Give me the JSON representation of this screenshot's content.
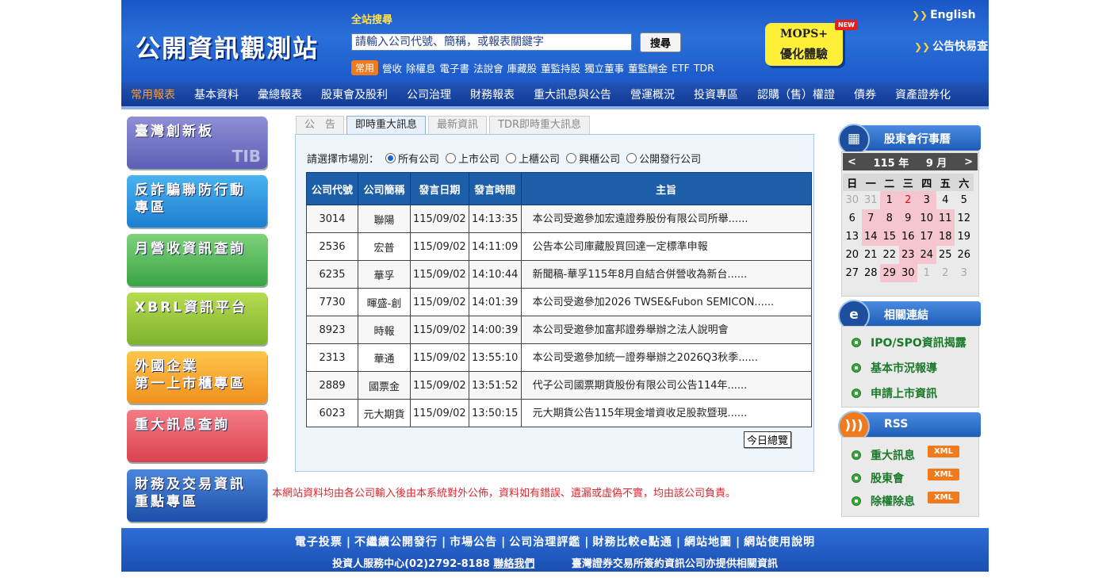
{
  "header": {
    "logo": "公開資訊觀測站",
    "search_label": "全站搜尋",
    "search_placeholder": "請輸入公司代號、簡稱，或報表關鍵字",
    "search_button": "搜尋",
    "quick_tag": "常用",
    "quick_links": [
      "營收",
      "除權息",
      "電子書",
      "法說會",
      "庫藏股",
      "董監持股",
      "獨立董事",
      "董監酬金",
      "ETF",
      "TDR"
    ],
    "mops_line1": "MOPS+",
    "mops_line2": "優化體驗",
    "mops_new": "NEW",
    "english": "English",
    "quick_announce": "公告快易查"
  },
  "nav": [
    "常用報表",
    "基本資料",
    "彙總報表",
    "股東會及股利",
    "公司治理",
    "財務報表",
    "重大訊息與公告",
    "營運概況",
    "投資專區",
    "認購（售）權證",
    "債券",
    "資產證券化"
  ],
  "banners": [
    {
      "label": "臺灣創新板",
      "deco": "TIB",
      "c1": "#8e8fd6",
      "c2": "#5c5fb4"
    },
    {
      "label": "反詐騙聯防行動\n專區",
      "deco": "",
      "c1": "#49b3ef",
      "c2": "#1c7fd1"
    },
    {
      "label": "月營收資訊查詢",
      "deco": "",
      "c1": "#7fd27a",
      "c2": "#3aa444"
    },
    {
      "label": "XBRL資訊平台",
      "deco": "",
      "c1": "#b5dc4e",
      "c2": "#7fb22e"
    },
    {
      "label": "外國企業\n第一上市櫃專區",
      "deco": "",
      "c1": "#ffc54a",
      "c2": "#f0901d"
    },
    {
      "label": "重大訊息查詢",
      "deco": "",
      "c1": "#f57b84",
      "c2": "#d9434f"
    },
    {
      "label": "財務及交易資訊\n重點專區",
      "deco": "",
      "c1": "#4a86d9",
      "c2": "#1d4ea8"
    }
  ],
  "tabs": [
    "公　告",
    "即時重大訊息",
    "最新資訊",
    "TDR即時重大訊息"
  ],
  "market_filter": {
    "label": "請選擇市場別：",
    "options": [
      "所有公司",
      "上市公司",
      "上櫃公司",
      "興櫃公司",
      "公開發行公司"
    ]
  },
  "news": {
    "columns": [
      "公司代號",
      "公司簡稱",
      "發言日期",
      "發言時間",
      "主旨"
    ],
    "rows": [
      [
        "3014",
        "聯陽",
        "115/09/02",
        "14:13:35",
        "本公司受邀參加宏遠證券股份有限公司所舉......"
      ],
      [
        "2536",
        "宏普",
        "115/09/02",
        "14:11:09",
        "公告本公司庫藏股買回達一定標準申報"
      ],
      [
        "6235",
        "華孚",
        "115/09/02",
        "14:10:44",
        "新聞稿-華孚115年8月自結合併營收為新台......"
      ],
      [
        "7730",
        "暉盛-創",
        "115/09/02",
        "14:01:39",
        "本公司受邀參加2026 TWSE&Fubon SEMICON......"
      ],
      [
        "8923",
        "時報",
        "115/09/02",
        "14:00:39",
        "本公司受邀參加富邦證券舉辦之法人說明會"
      ],
      [
        "2313",
        "華通",
        "115/09/02",
        "13:55:10",
        "本公司受邀參加統一證券舉辦之2026Q3秋季......"
      ],
      [
        "2889",
        "國票金",
        "115/09/02",
        "13:51:52",
        "代子公司國票期貨股份有限公司公告114年......"
      ],
      [
        "6023",
        "元大期貨",
        "115/09/02",
        "13:50:15",
        "元大期貨公告115年現金增資收足股款暨現......"
      ]
    ],
    "today_button": "今日總覽"
  },
  "disclaimer": "本網站資料均由各公司輸入後由本系統對外公佈，資料如有錯誤、遺漏或虛偽不實，均由該公司負責。",
  "calendar": {
    "title": "股東會行事曆",
    "prev": "<",
    "next": ">",
    "year": "115 年",
    "month": "9 月",
    "weekdays": [
      "日",
      "一",
      "二",
      "三",
      "四",
      "五",
      "六"
    ],
    "weeks": [
      [
        {
          "d": "30",
          "o": 1
        },
        {
          "d": "31",
          "o": 1
        },
        {
          "d": "1",
          "e": 1
        },
        {
          "d": "2",
          "e": 1,
          "r": 1
        },
        {
          "d": "3",
          "e": 1
        },
        {
          "d": "4"
        },
        {
          "d": "5"
        }
      ],
      [
        {
          "d": "6"
        },
        {
          "d": "7",
          "e": 1
        },
        {
          "d": "8",
          "e": 1
        },
        {
          "d": "9",
          "e": 1
        },
        {
          "d": "10",
          "e": 1
        },
        {
          "d": "11",
          "e": 1
        },
        {
          "d": "12"
        }
      ],
      [
        {
          "d": "13"
        },
        {
          "d": "14",
          "e": 1
        },
        {
          "d": "15",
          "e": 1
        },
        {
          "d": "16",
          "e": 1
        },
        {
          "d": "17",
          "e": 1
        },
        {
          "d": "18",
          "e": 1
        },
        {
          "d": "19"
        }
      ],
      [
        {
          "d": "20"
        },
        {
          "d": "21"
        },
        {
          "d": "22"
        },
        {
          "d": "23",
          "e": 1
        },
        {
          "d": "24",
          "e": 1
        },
        {
          "d": "25"
        },
        {
          "d": "26"
        }
      ],
      [
        {
          "d": "27"
        },
        {
          "d": "28"
        },
        {
          "d": "29",
          "e": 1
        },
        {
          "d": "30",
          "e": 1
        },
        {
          "d": "1",
          "o": 1
        },
        {
          "d": "2",
          "o": 1
        },
        {
          "d": "3",
          "o": 1
        }
      ]
    ]
  },
  "related": {
    "title": "相關連結",
    "links": [
      "IPO/SPO資訊揭露",
      "基本市況報導",
      "申請上市資訊"
    ]
  },
  "rss": {
    "title": "RSS",
    "links": [
      "重大訊息",
      "股東會",
      "除權除息"
    ],
    "badge": "XML"
  },
  "footer": {
    "links": [
      "電子投票",
      "不繼續公開發行",
      "市場公告",
      "公司治理評鑑",
      "財務比較e點通",
      "網站地圖",
      "網站使用說明"
    ],
    "service": "投資人服務中心(02)2792-8188",
    "contact": "聯絡我們",
    "provider": "臺灣證券交易所簽約資訊公司亦提供相關資訊"
  }
}
